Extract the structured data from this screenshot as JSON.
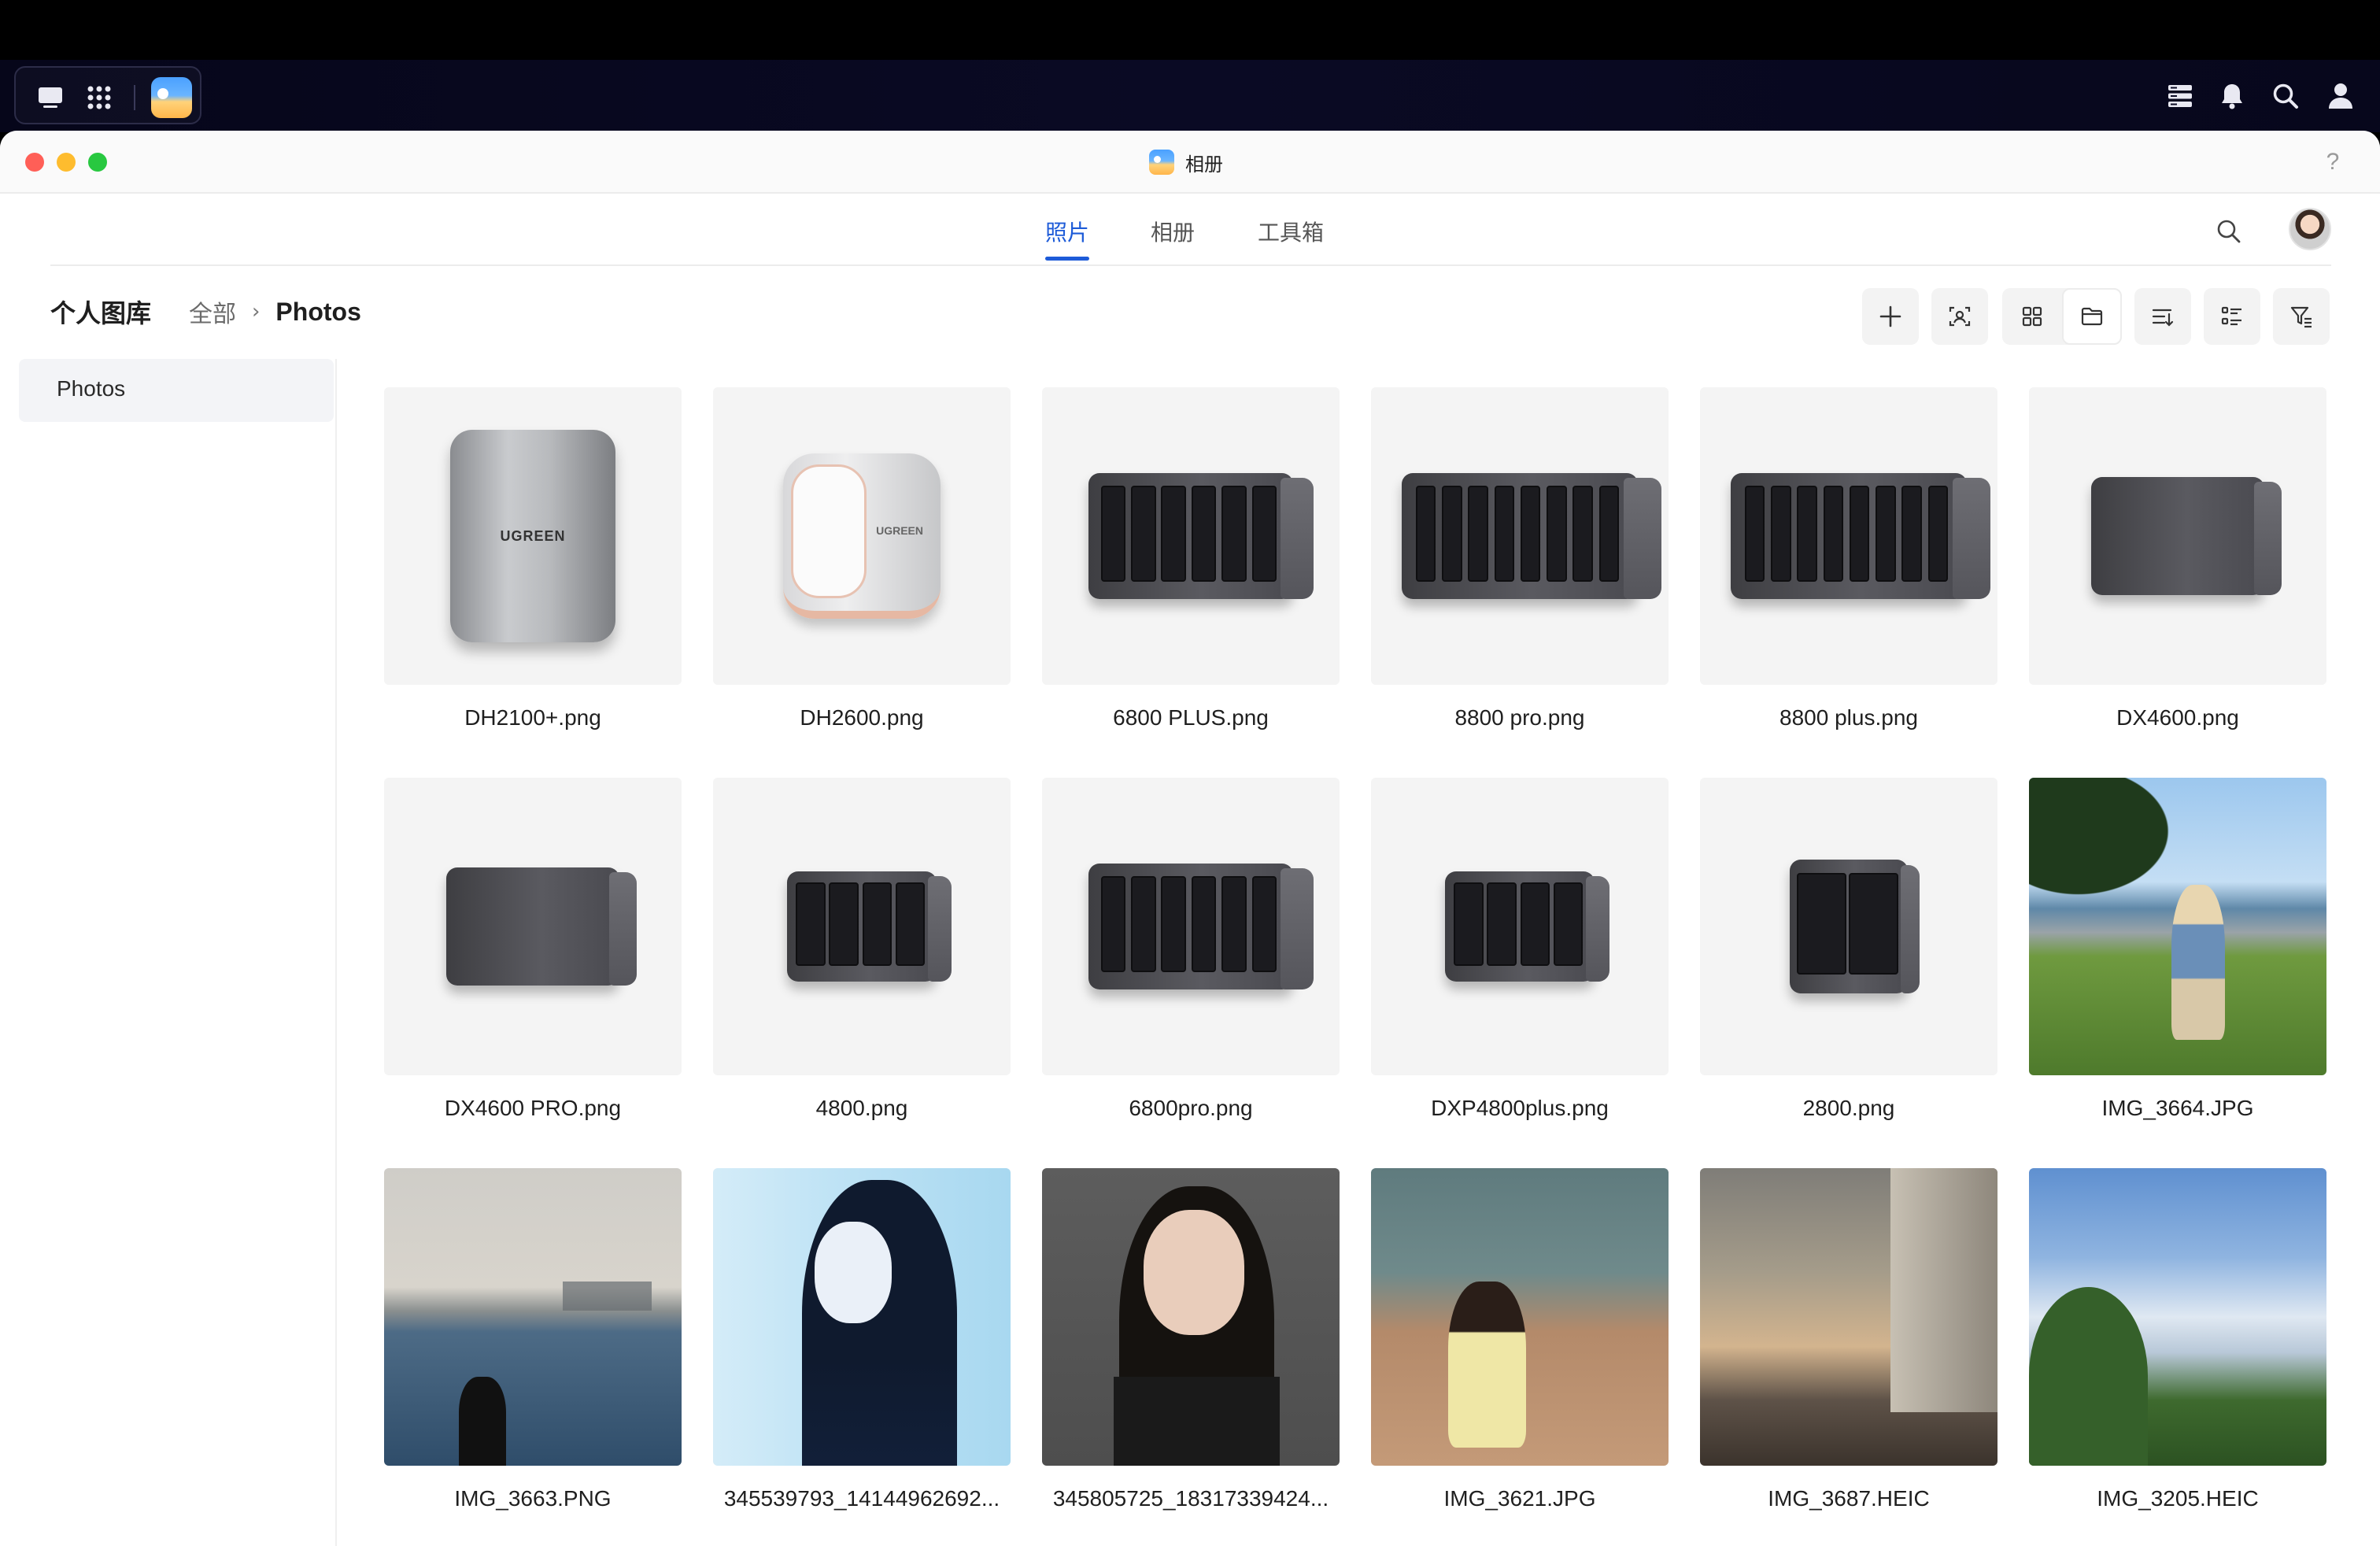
{
  "window": {
    "title": "相册",
    "help_label": "?"
  },
  "nav": {
    "tabs": [
      {
        "label": "照片",
        "active": true
      },
      {
        "label": "相册",
        "active": false
      },
      {
        "label": "工具箱",
        "active": false
      }
    ]
  },
  "toolbar": {
    "library_title": "个人图库",
    "breadcrumb": {
      "root": "全部",
      "separator": "›",
      "current": "Photos"
    }
  },
  "sidebar": {
    "items": [
      {
        "label": "Photos",
        "selected": true
      }
    ]
  },
  "photos": [
    {
      "name": "DH2100+.png",
      "kind": "tower"
    },
    {
      "name": "DH2600.png",
      "kind": "compact"
    },
    {
      "name": "6800 PLUS.png",
      "kind": "nas-6"
    },
    {
      "name": "8800 pro.png",
      "kind": "nas-8"
    },
    {
      "name": "8800 plus.png",
      "kind": "nas-8"
    },
    {
      "name": "DX4600.png",
      "kind": "box"
    },
    {
      "name": "DX4600 PRO.png",
      "kind": "box"
    },
    {
      "name": "4800.png",
      "kind": "nas-4"
    },
    {
      "name": "6800pro.png",
      "kind": "nas-6"
    },
    {
      "name": "DXP4800plus.png",
      "kind": "nas-4"
    },
    {
      "name": "2800.png",
      "kind": "nas-2"
    },
    {
      "name": "IMG_3664.JPG",
      "kind": "photo-park"
    },
    {
      "name": "IMG_3663.PNG",
      "kind": "photo-sea"
    },
    {
      "name": "345539793_14144962692...",
      "kind": "photo-portrait-blue"
    },
    {
      "name": "345805725_18317339424...",
      "kind": "photo-portrait-dark"
    },
    {
      "name": "IMG_3621.JPG",
      "kind": "photo-rocks"
    },
    {
      "name": "IMG_3687.HEIC",
      "kind": "photo-sunset"
    },
    {
      "name": "IMG_3205.HEIC",
      "kind": "photo-sky"
    }
  ],
  "colors": {
    "accent": "#1d5bd8",
    "traffic_close": "#ff5f57",
    "traffic_min": "#febc2e",
    "traffic_max": "#28c840"
  },
  "icons": {
    "taskbar": [
      "desktop-icon",
      "apps-grid-icon",
      "photos-app-icon"
    ],
    "tray": [
      "task-manager-icon",
      "bell-icon",
      "search-icon",
      "user-icon"
    ],
    "tools": [
      "add-icon",
      "face-scan-icon",
      "grid-view-icon",
      "folder-view-icon",
      "sort-icon",
      "list-view-icon",
      "filter-icon"
    ]
  }
}
